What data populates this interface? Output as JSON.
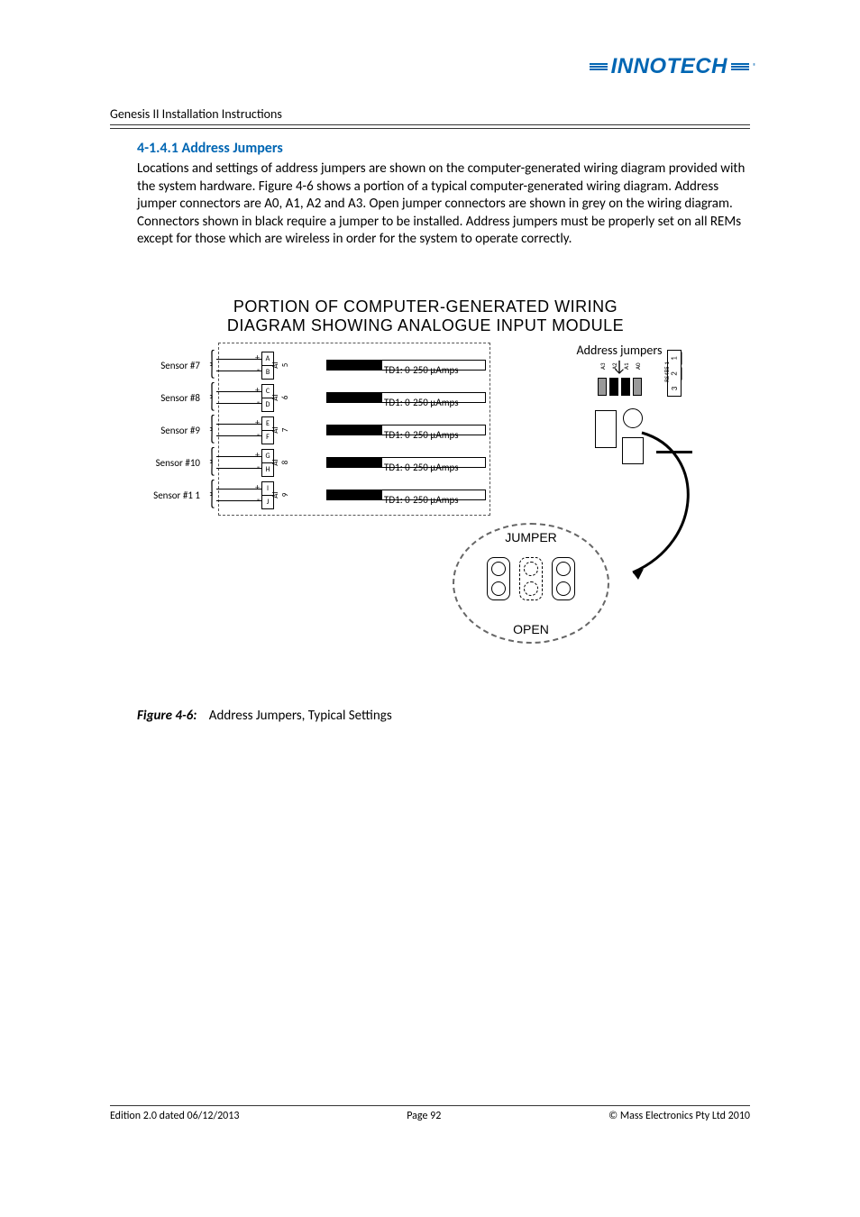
{
  "brand": "INNOTECH",
  "doc_title": "Genesis II Installation Instructions",
  "section_heading": "4-1.4.1 Address Jumpers",
  "body_text": "Locations and settings of address jumpers are shown on the computer-generated wiring diagram provided with the system hardware.  Figure 4-6 shows a portion of a typical computer-generated wiring diagram. Address jumper connectors are A0, A1, A2 and A3.  Open jumper connectors are shown in grey on the wiring diagram.  Connectors shown in black require a jumper to be installed.  Address jumpers must be properly set on all REMs except for those which are wireless in order for the system to operate correctly.",
  "diagram": {
    "title_l1": "PORTION OF COMPUTER-GENERATED WIRING",
    "title_l2": "DIAGRAM SHOWING ANALOGUE INPUT MODULE",
    "sensors": [
      {
        "label": "Sensor #7",
        "termA": "A",
        "termB": "B",
        "ai": "AI 5",
        "td": "TD1: 0-250 µAmps"
      },
      {
        "label": "Sensor #8",
        "termA": "C",
        "termB": "D",
        "ai": "AI 6",
        "td": "TD1: 0-250 µAmps"
      },
      {
        "label": "Sensor #9",
        "termA": "E",
        "termB": "F",
        "ai": "AI 7",
        "td": "TD1: 0-250 µAmps"
      },
      {
        "label": "Sensor #10",
        "termA": "G",
        "termB": "H",
        "ai": "AI 8",
        "td": "TD1: 0-250 µAmps"
      },
      {
        "label": "Sensor #1  1",
        "termA": "I",
        "termB": "J",
        "ai": "AI 9",
        "td": "TD1: 0-250 µAmps"
      }
    ],
    "address_label": "Address jumpers",
    "address_pins": [
      "A3",
      "A2",
      "A1",
      "A0"
    ],
    "right_terms": [
      "1",
      "2",
      "3"
    ],
    "right_side": "RS485 1",
    "detail": {
      "jumper": "JUMPER",
      "open": "OPEN"
    }
  },
  "figure": {
    "num": "Figure 4-6:",
    "caption": "Address Jumpers, Typical Settings"
  },
  "footer": {
    "left": "Edition 2.0 dated 06/12/2013",
    "center": "Page 92",
    "right": "©  Mass Electronics Pty Ltd  2010"
  }
}
